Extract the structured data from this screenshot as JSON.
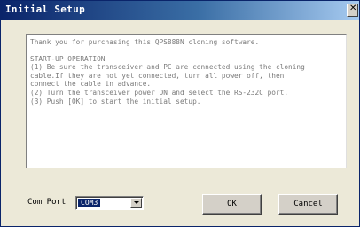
{
  "window": {
    "title": "Initial Setup"
  },
  "message": {
    "line1": "Thank you for purchasing this QPS888N cloning software.",
    "line2": "START-UP OPERATION",
    "line3": "(1) Be sure the transceiver and PC are connected using the cloning",
    "line4": "cable.If they are not yet connected, turn all power off, then",
    "line5": "connect the cable in advance.",
    "line6": "(2) Turn the transceiver power ON and select the RS-232C port.",
    "line7": "(3) Push [OK] to start the initial setup."
  },
  "com_port": {
    "label": "Com Port",
    "selected": "COM3"
  },
  "buttons": {
    "ok_mnemonic": "O",
    "ok_rest": "K",
    "cancel_mnemonic": "C",
    "cancel_rest": "ancel"
  }
}
